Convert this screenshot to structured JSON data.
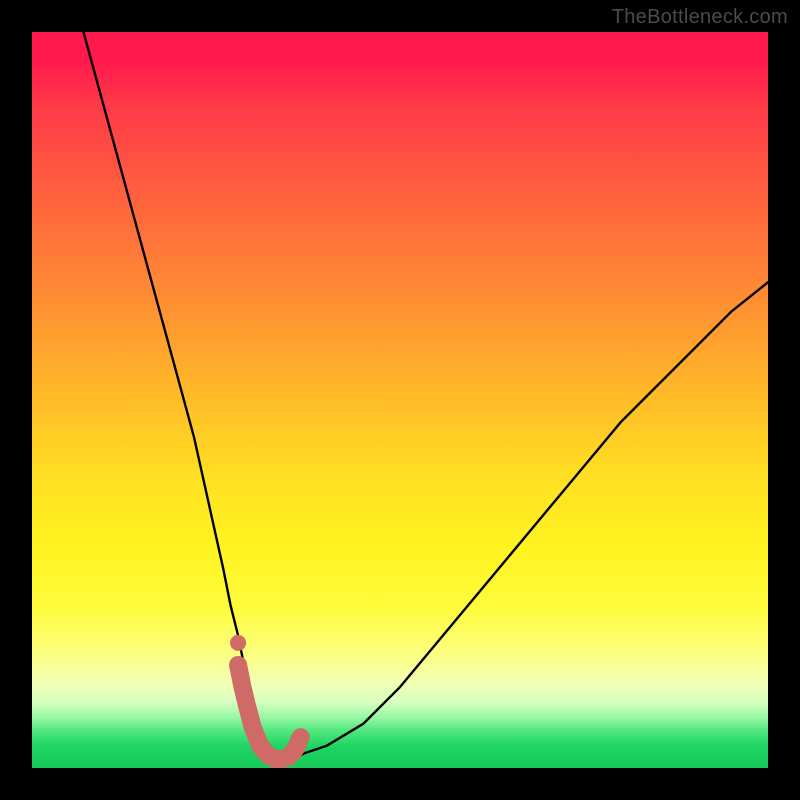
{
  "watermark": "TheBottleneck.com",
  "colors": {
    "page_bg": "#000000",
    "curve_stroke": "#000000",
    "marker_stroke": "#cf6a67",
    "marker_dot": "#cf6a67",
    "gradient_top": "#ff1a4d",
    "gradient_bottom": "#18c959"
  },
  "chart_data": {
    "type": "line",
    "title": "",
    "xlabel": "",
    "ylabel": "",
    "xlim": [
      0,
      100
    ],
    "ylim": [
      0,
      100
    ],
    "grid": false,
    "legend": false,
    "series": [
      {
        "name": "bottleneck-curve",
        "x": [
          7,
          10,
          13,
          16,
          19,
          22,
          24,
          26,
          27,
          28,
          29,
          30,
          31,
          32,
          33,
          34,
          35,
          37,
          40,
          45,
          50,
          55,
          60,
          65,
          70,
          75,
          80,
          85,
          90,
          95,
          100
        ],
        "values": [
          100,
          89,
          78,
          67,
          56,
          45,
          36,
          27,
          22,
          18,
          13,
          8,
          4,
          2,
          1,
          1,
          1,
          2,
          3,
          6,
          11,
          17,
          23,
          29,
          35,
          41,
          47,
          52,
          57,
          62,
          66
        ]
      }
    ],
    "highlight": {
      "name": "marker-segment",
      "x": [
        28.0,
        28.6,
        29.2,
        30.0,
        31.0,
        32.0,
        33.0,
        34.0,
        35.0,
        35.8,
        36.5
      ],
      "values": [
        14.0,
        11.0,
        8.5,
        5.5,
        3.0,
        1.8,
        1.2,
        1.2,
        1.6,
        2.6,
        4.2
      ],
      "dot": {
        "x": 28.0,
        "y": 17.0
      }
    }
  }
}
